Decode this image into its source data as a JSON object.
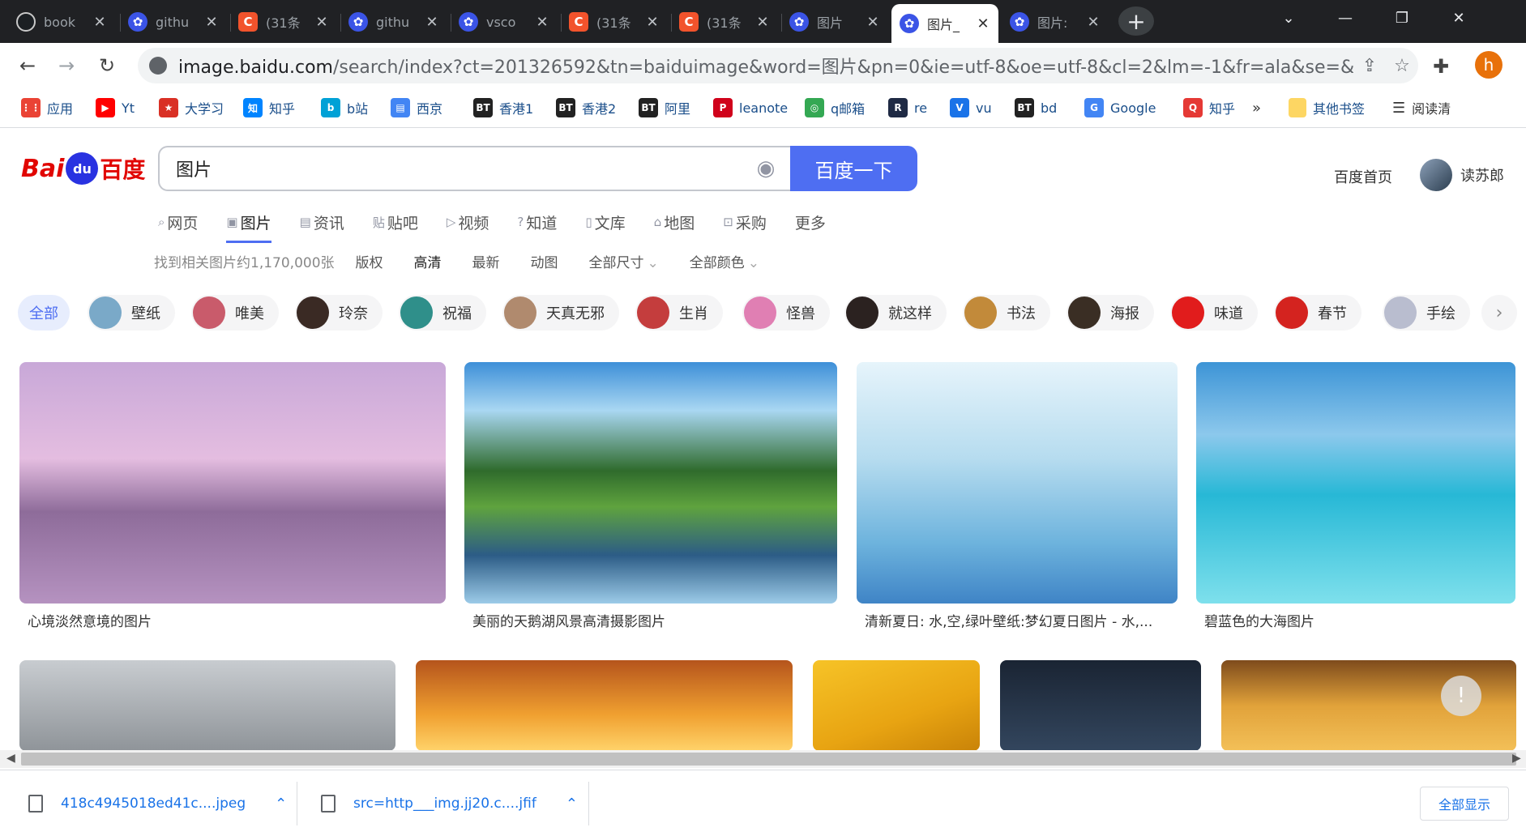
{
  "tabs": [
    {
      "title": "book",
      "favicon": "github-icon"
    },
    {
      "title": "githu",
      "favicon": "baidu-paw-icon"
    },
    {
      "title": "(31条",
      "favicon": "csdn-icon"
    },
    {
      "title": "githu",
      "favicon": "baidu-paw-icon"
    },
    {
      "title": "vsco",
      "favicon": "baidu-paw-icon"
    },
    {
      "title": "(31条",
      "favicon": "csdn-icon"
    },
    {
      "title": "(31条",
      "favicon": "csdn-icon"
    },
    {
      "title": "图片",
      "favicon": "baidu-paw-icon"
    },
    {
      "title": "图片_",
      "favicon": "baidu-paw-icon",
      "active": true
    },
    {
      "title": "图片:",
      "favicon": "baidu-paw-icon"
    }
  ],
  "address_bar": {
    "host": "image.baidu.com",
    "path": "/search/index?ct=201326592&tn=baiduimage&word=图片&pn=0&ie=utf-8&oe=utf-8&cl=2&lm=-1&fr=ala&se=&s..."
  },
  "profile_initial": "h",
  "bookmarks": [
    {
      "label": "应用",
      "color": "#ea4335",
      "glyph": "⋮⋮"
    },
    {
      "label": "Yt",
      "color": "#ff0000",
      "glyph": "▶"
    },
    {
      "label": "大学习",
      "color": "#d93025",
      "glyph": "★"
    },
    {
      "label": "知乎",
      "color": "#0084ff",
      "glyph": "知"
    },
    {
      "label": "b站",
      "color": "#00a1d6",
      "glyph": "b"
    },
    {
      "label": "西京",
      "color": "#4285f4",
      "glyph": "▤"
    },
    {
      "label": "香港1",
      "color": "#222222",
      "glyph": "BT"
    },
    {
      "label": "香港2",
      "color": "#222222",
      "glyph": "BT"
    },
    {
      "label": "阿里",
      "color": "#222222",
      "glyph": "BT"
    },
    {
      "label": "leanote",
      "color": "#d0021b",
      "glyph": "P"
    },
    {
      "label": "q邮箱",
      "color": "#34a853",
      "glyph": "◎"
    },
    {
      "label": "re",
      "color": "#1f2a44",
      "glyph": "R"
    },
    {
      "label": "vu",
      "color": "#1a73e8",
      "glyph": "V"
    },
    {
      "label": "bd",
      "color": "#222222",
      "glyph": "BT"
    },
    {
      "label": "Google",
      "color": "#4285f4",
      "glyph": "G"
    },
    {
      "label": "知乎",
      "color": "#e53935",
      "glyph": "Q"
    }
  ],
  "bookmarks_overflow": "»",
  "other_bookmarks": "其他书签",
  "reading_list": "阅读清",
  "logo": {
    "bai": "Bai",
    "du": "du",
    "cn": "百度"
  },
  "search": {
    "query": "图片",
    "button": "百度一下"
  },
  "header_links": {
    "home": "百度首页",
    "user": "读苏郎"
  },
  "vertical_tabs": [
    {
      "label": "网页",
      "icon": "⌕"
    },
    {
      "label": "图片",
      "icon": "▣",
      "active": true
    },
    {
      "label": "资讯",
      "icon": "▤"
    },
    {
      "label": "贴吧",
      "icon": "贴"
    },
    {
      "label": "视频",
      "icon": "▷"
    },
    {
      "label": "知道",
      "icon": "?"
    },
    {
      "label": "文库",
      "icon": "▯"
    },
    {
      "label": "地图",
      "icon": "⌂"
    },
    {
      "label": "采购",
      "icon": "⊡"
    },
    {
      "label": "更多",
      "icon": ""
    }
  ],
  "filters": {
    "count": "找到相关图片约1,170,000张",
    "items": [
      {
        "label": "版权"
      },
      {
        "label": "高清",
        "strong": true
      },
      {
        "label": "最新"
      },
      {
        "label": "动图"
      },
      {
        "label": "全部尺寸",
        "dropdown": true
      },
      {
        "label": "全部颜色",
        "dropdown": true
      }
    ]
  },
  "tags": [
    {
      "label": "全部",
      "active": true
    },
    {
      "label": "壁纸",
      "color": "#7aa9c8"
    },
    {
      "label": "唯美",
      "color": "#c95b6b"
    },
    {
      "label": "玲奈",
      "color": "#3a2a24"
    },
    {
      "label": "祝福",
      "color": "#2f8f8a"
    },
    {
      "label": "天真无邪",
      "color": "#b08a6e"
    },
    {
      "label": "生肖",
      "color": "#c43d3d"
    },
    {
      "label": "怪兽",
      "color": "#e07fb3"
    },
    {
      "label": "就这样",
      "color": "#2b2220"
    },
    {
      "label": "书法",
      "color": "#c28a3a"
    },
    {
      "label": "海报",
      "color": "#3a2e24"
    },
    {
      "label": "味道",
      "color": "#e11c1c"
    },
    {
      "label": "春节",
      "color": "#d4231f"
    },
    {
      "label": "手绘",
      "color": "#b9bdcf"
    }
  ],
  "images": [
    {
      "caption": "心境淡然意境的图片",
      "bg": "linear-gradient(180deg,#c8a8d8 0%,#e4bde0 40%,#8e6c9a 62%,#b592c0 100%)"
    },
    {
      "caption": "美丽的天鹅湖风景高清摄影图片",
      "bg": "linear-gradient(180deg,#3d8fd8 0%,#a9d7f2 20%,#2f6b2c 45%,#5fa33e 60%,#2c5c86 80%,#9ccbe8 100%)"
    },
    {
      "caption": "清新夏日: 水,空,绿叶壁纸:梦幻夏日图片 - 水,...",
      "bg": "linear-gradient(180deg,#e6f4fb 0%,#b6dcef 40%,#6db3dd 75%,#3f84c6 100%)"
    },
    {
      "caption": "碧蓝色的大海图片",
      "bg": "linear-gradient(180deg,#3d94d6 0%,#8cc8ec 30%,#27b8d6 55%,#7ee0ec 100%)"
    },
    {
      "caption": "",
      "bg": "linear-gradient(180deg,#c8ccd0 0%,#8f9499 100%)"
    },
    {
      "caption": "",
      "bg": "linear-gradient(180deg,#b5541c 0%,#f0a030 60%,#ffd36a 100%)"
    },
    {
      "caption": "",
      "bg": "linear-gradient(160deg,#f6c327 0%,#e8a412 60%,#c98308 100%)"
    },
    {
      "caption": "",
      "bg": "linear-gradient(180deg,#1a2433 0%,#33465e 100%)"
    },
    {
      "caption": "",
      "bg": "linear-gradient(180deg,#7e4b1c 0%,#e1a23a 50%,#f3c058 100%)"
    }
  ],
  "feedback": "!",
  "downloads": [
    {
      "file": "418c4945018ed41c....jpeg"
    },
    {
      "file": "src=http___img.jj20.c....jfif"
    }
  ],
  "show_all": "全部显示"
}
